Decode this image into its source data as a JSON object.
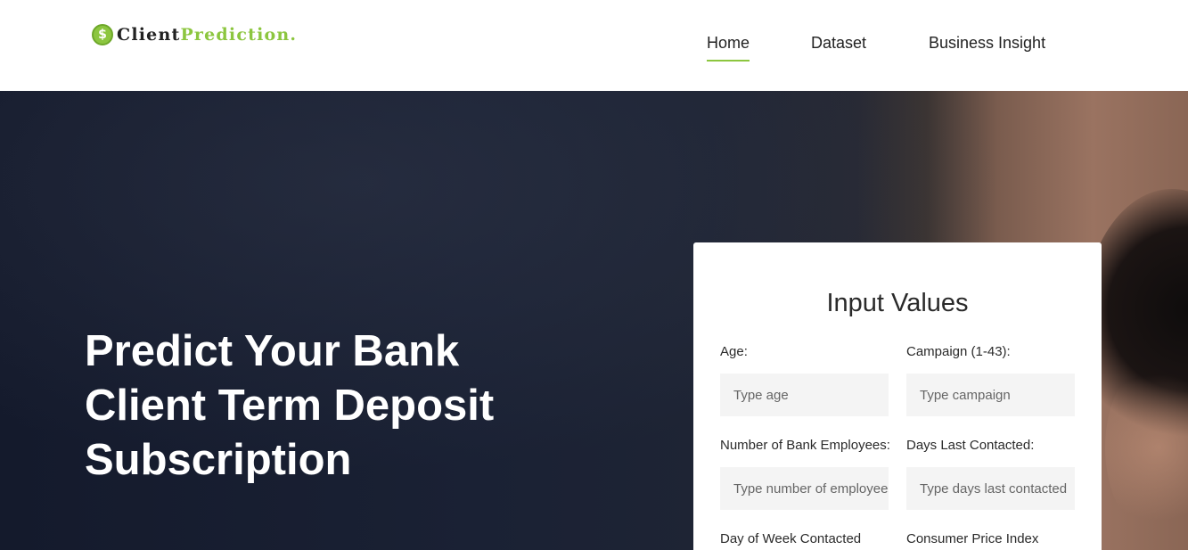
{
  "logo": {
    "icon_name": "dollar-coin-icon",
    "symbol": "$",
    "text_primary": "Client",
    "text_accent": "Prediction."
  },
  "nav": {
    "items": [
      {
        "label": "Home",
        "active": true
      },
      {
        "label": "Dataset",
        "active": false
      },
      {
        "label": "Business Insight",
        "active": false
      }
    ]
  },
  "hero": {
    "title_lines": [
      "Predict Your Bank",
      "Client Term Deposit",
      "Subscription"
    ]
  },
  "form": {
    "title": "Input Values",
    "fields": [
      {
        "label": "Age:",
        "placeholder": "Type age"
      },
      {
        "label": "Campaign (1-43):",
        "placeholder": "Type campaign"
      },
      {
        "label": "Number of Bank Employees:",
        "placeholder": "Type number of employees"
      },
      {
        "label": "Days Last Contacted:",
        "placeholder": "Type days last contacted"
      },
      {
        "label": "Day of Week Contacted",
        "placeholder": ""
      },
      {
        "label": "Consumer Price Index",
        "placeholder": ""
      }
    ]
  },
  "colors": {
    "accent": "#8cc63f",
    "hero_dark": "#141a2c",
    "card_bg": "#ffffff",
    "input_bg": "#f4f4f4"
  }
}
